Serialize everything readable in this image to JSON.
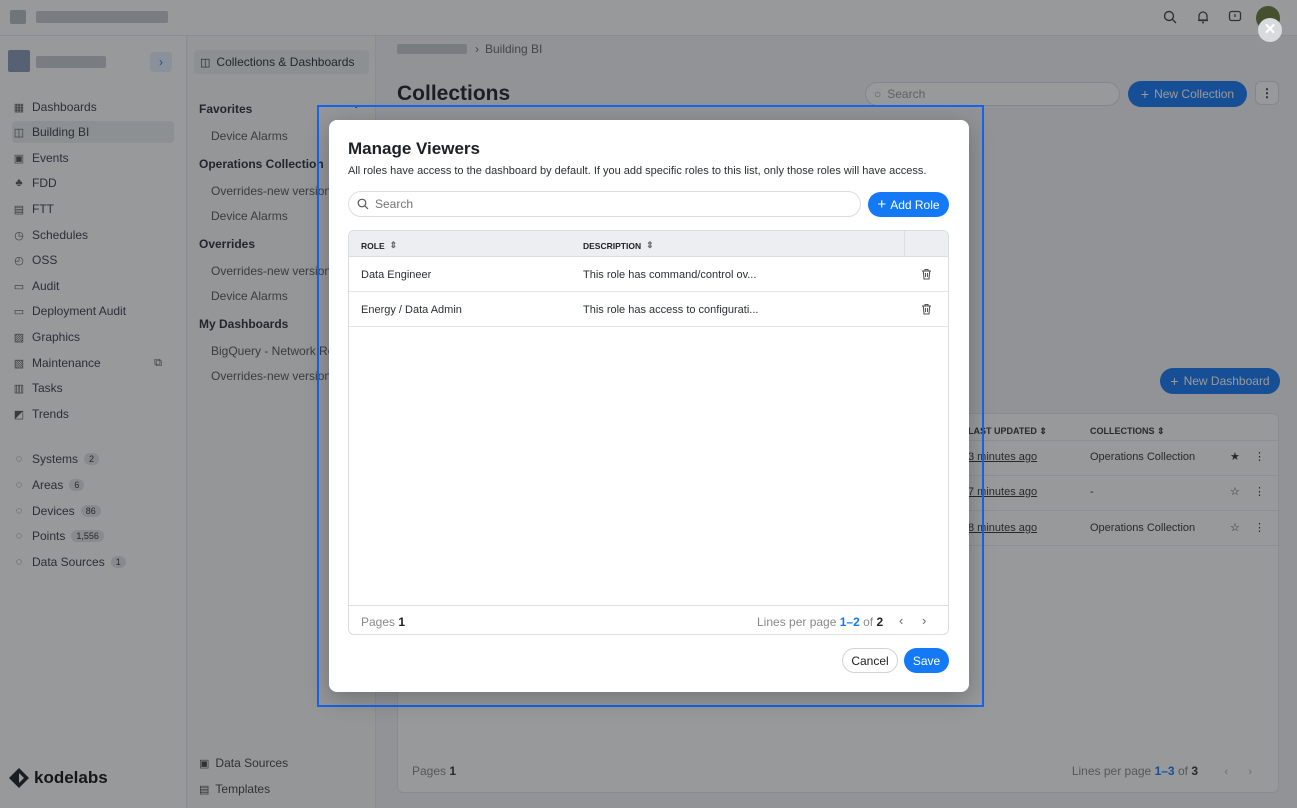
{
  "app": {
    "breadcrumb_current": "Building BI",
    "sidebar": {
      "items": [
        {
          "label": "Dashboards",
          "icon": "grid-icon"
        },
        {
          "label": "Building BI",
          "icon": "chart-icon",
          "active": true
        },
        {
          "label": "Events",
          "icon": "events-icon"
        },
        {
          "label": "FDD",
          "icon": "tree-icon"
        },
        {
          "label": "FTT",
          "icon": "clipboard-icon"
        },
        {
          "label": "Schedules",
          "icon": "clock-icon"
        },
        {
          "label": "OSS",
          "icon": "timer-icon"
        },
        {
          "label": "Audit",
          "icon": "file-icon"
        },
        {
          "label": "Deployment Audit",
          "icon": "file-icon"
        },
        {
          "label": "Graphics",
          "icon": "image-icon"
        },
        {
          "label": "Maintenance",
          "icon": "wrench-icon"
        },
        {
          "label": "Tasks",
          "icon": "list-icon"
        },
        {
          "label": "Trends",
          "icon": "trend-icon"
        }
      ],
      "resources": [
        {
          "label": "Systems",
          "count": "2"
        },
        {
          "label": "Areas",
          "count": "6"
        },
        {
          "label": "Devices",
          "count": "86"
        },
        {
          "label": "Points",
          "count": "1,556"
        },
        {
          "label": "Data Sources",
          "count": "1"
        }
      ],
      "logo_text": "kodelabs"
    },
    "panel": {
      "header": "Collections & Dashboards",
      "sections": [
        {
          "title": "Favorites",
          "links": [
            "Device Alarms"
          ]
        },
        {
          "title": "Operations Collection",
          "links": [
            "Overrides-new version",
            "Device Alarms"
          ]
        },
        {
          "title": "Overrides",
          "links": [
            "Overrides-new version",
            "Device Alarms"
          ]
        },
        {
          "title": "My Dashboards",
          "links": [
            "BigQuery - Network Re",
            "Overrides-new version"
          ]
        }
      ],
      "footer": [
        "Data Sources",
        "Templates"
      ]
    },
    "main": {
      "title": "Collections",
      "search_placeholder": "Search",
      "new_collection": "New Collection",
      "new_dashboard": "New Dashboard",
      "table": {
        "headers": [
          "LAST UPDATED",
          "COLLECTIONS"
        ],
        "rows": [
          {
            "updated": "3 minutes ago",
            "collection": "Operations Collection"
          },
          {
            "updated": "7 minutes ago",
            "collection": "-"
          },
          {
            "updated": "8 minutes ago",
            "collection": "Operations Collection"
          }
        ],
        "pages_label": "Pages",
        "pages_value": "1",
        "lines_label": "Lines per page",
        "lines_range": "1–3",
        "lines_of": "of",
        "lines_total": "3"
      }
    }
  },
  "modal": {
    "title": "Manage Viewers",
    "description": "All roles have access to the dashboard by default. If you add specific roles to this list, only those roles will have access.",
    "search_placeholder": "Search",
    "add_role_label": "Add Role",
    "columns": [
      "ROLE",
      "DESCRIPTION"
    ],
    "rows": [
      {
        "role": "Data Engineer",
        "description": "This role has command/control ov..."
      },
      {
        "role": "Energy / Data Admin",
        "description": "This role has access to configurati..."
      }
    ],
    "footer": {
      "pages_label": "Pages",
      "pages_value": "1",
      "lines_label": "Lines per page",
      "lines_range": "1–2",
      "lines_of": "of",
      "lines_total": "2"
    },
    "cancel_label": "Cancel",
    "save_label": "Save"
  },
  "colors": {
    "accent": "#1479f5",
    "focus_outline": "#1663f0",
    "overlay": "rgba(25,28,33,0.45)"
  }
}
